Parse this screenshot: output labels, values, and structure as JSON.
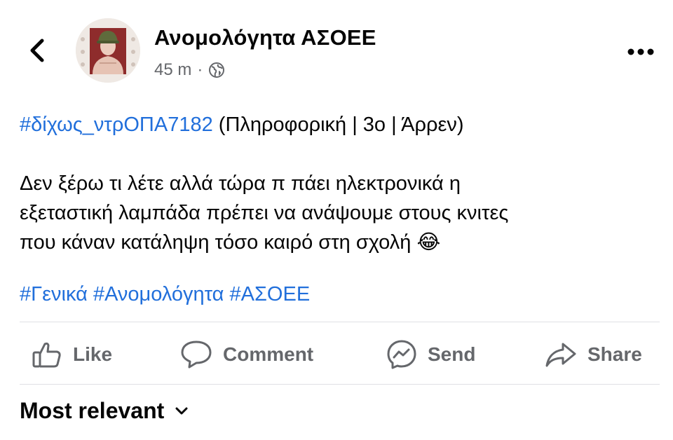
{
  "header": {
    "page_name": "Ανομολόγητα ΑΣΟΕΕ",
    "timestamp": "45 m",
    "separator": "·",
    "audience_icon": "globe-icon",
    "back_icon": "chevron-left-icon",
    "more_icon": "more-horizontal-icon"
  },
  "post": {
    "first_line": {
      "hashtag": "#δίχως_ντρΟΠΑ7182",
      "details": "(Πληροφορική | 3ο | Άρρεν)"
    },
    "body_lines": [
      "Δεν ξέρω τι λέτε αλλά τώρα π πάει ηλεκτρονικά η",
      "εξεταστική λαμπάδα πρέπει να ανάψουμε στους κνιτες",
      "που κάναν κατάληψη τόσο καιρό στη σχολή"
    ],
    "emoji": "😂",
    "hashtags": [
      "#Γενικά",
      "#Ανομολόγητα",
      "#ΑΣΟΕΕ"
    ]
  },
  "actions": [
    {
      "label": "Like",
      "icon": "thumbs-up-icon"
    },
    {
      "label": "Comment",
      "icon": "comment-icon"
    },
    {
      "label": "Send",
      "icon": "messenger-icon"
    },
    {
      "label": "Share",
      "icon": "share-icon"
    }
  ],
  "comments": {
    "sort_label": "Most relevant",
    "sort_icon": "chevron-down-icon"
  },
  "colors": {
    "hashtag": "#216fdb",
    "secondary_text": "#65676b",
    "divider": "#dfe0e4"
  }
}
